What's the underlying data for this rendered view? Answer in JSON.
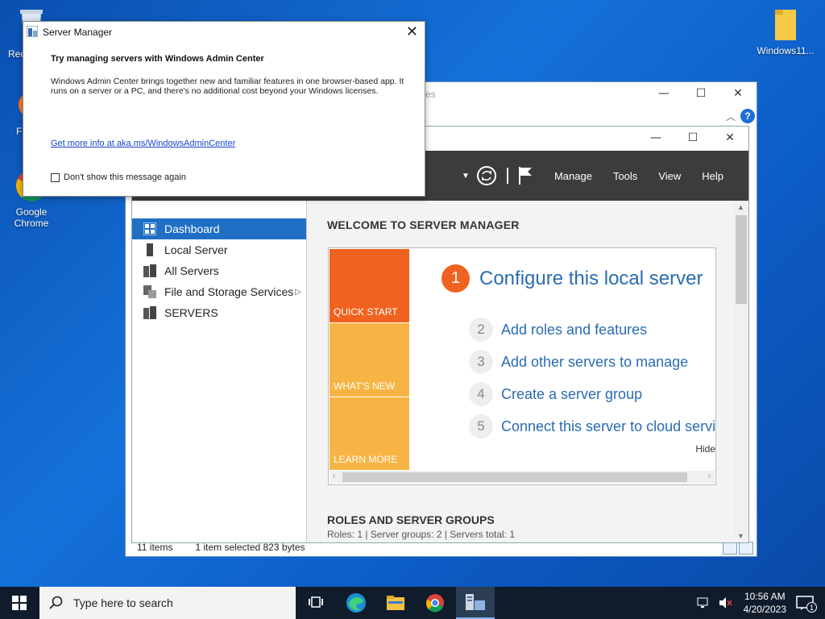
{
  "desktop": {
    "icons": [
      {
        "label": "Rec",
        "name": "recycle-bin"
      },
      {
        "label": "Fi",
        "name": "firefox"
      },
      {
        "label": "Google Chrome",
        "name": "google-chrome"
      },
      {
        "label": "Windows11...",
        "name": "folder-windows11"
      }
    ]
  },
  "explorer": {
    "title_fragment": "es",
    "status_items": "11 items",
    "status_selected": "1 item selected  823 bytes",
    "help_label": "?"
  },
  "server_manager": {
    "toolbar": {
      "menu": [
        "Manage",
        "Tools",
        "View",
        "Help"
      ]
    },
    "nav": [
      {
        "label": "Dashboard",
        "icon": "dashboard-icon",
        "active": true
      },
      {
        "label": "Local Server",
        "icon": "server-icon",
        "active": false
      },
      {
        "label": "All Servers",
        "icon": "servers-icon",
        "active": false
      },
      {
        "label": "File and Storage Services",
        "icon": "storage-icon",
        "active": false,
        "has_children": true
      },
      {
        "label": "SERVERS",
        "icon": "servers-group-icon",
        "active": false
      }
    ],
    "welcome_title": "WELCOME TO SERVER MANAGER",
    "tiles": [
      "QUICK START",
      "WHAT'S NEW",
      "LEARN MORE"
    ],
    "steps": [
      {
        "num": "1",
        "label": "Configure this local server"
      },
      {
        "num": "2",
        "label": "Add roles and features"
      },
      {
        "num": "3",
        "label": "Add other servers to manage"
      },
      {
        "num": "4",
        "label": "Create a server group"
      },
      {
        "num": "5",
        "label": "Connect this server to cloud servic"
      }
    ],
    "hide_label": "Hide",
    "roles_title": "ROLES AND SERVER GROUPS",
    "roles_summary": "Roles: 1   |   Server groups: 2   |   Servers total: 1"
  },
  "dialog": {
    "title": "Server Manager",
    "heading": "Try managing servers with Windows Admin Center",
    "body": "Windows Admin Center brings together new and familiar features in one browser-based app. It runs on a server or a PC, and there's no additional cost beyond your Windows licenses.",
    "link": "Get more info at aka.ms/WindowsAdminCenter",
    "checkbox_label": "Don't show this message again"
  },
  "taskbar": {
    "search_placeholder": "Type here to search",
    "time": "10:56 AM",
    "date": "4/20/2023",
    "notifications": "1"
  },
  "colors": {
    "accent_orange": "#f0621f",
    "tile_light_orange": "#f7b444",
    "nav_active": "#1f6fc5",
    "link_blue": "#2a6cb1"
  }
}
